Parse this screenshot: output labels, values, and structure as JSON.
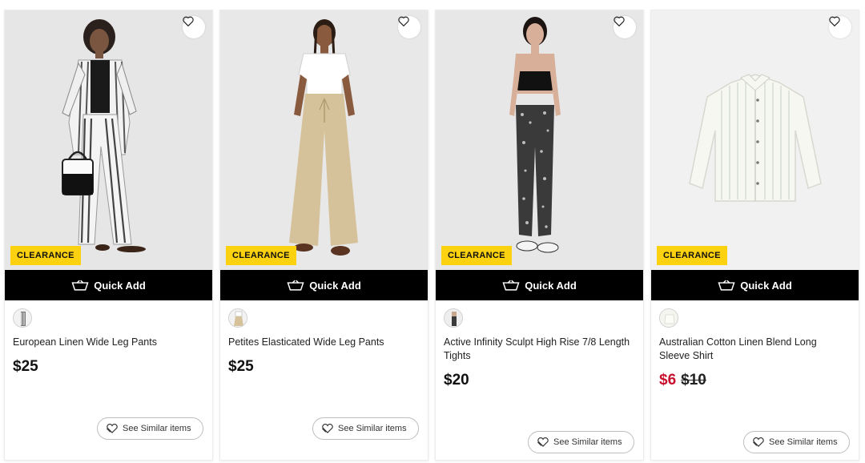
{
  "actions": {
    "quick_add": "Quick Add",
    "see_similar": "See Similar items"
  },
  "colors": {
    "clearance_badge": "#fcd10f",
    "quick_add_bg": "#000000",
    "sale_price": "#c8102e"
  },
  "products": [
    {
      "badge": "CLEARANCE",
      "name": "European Linen Wide Leg Pants",
      "price": "$25",
      "image": "model-striped-linen-outfit",
      "icons": [
        "heart-icon",
        "basket-icon",
        "similar-icon"
      ]
    },
    {
      "badge": "CLEARANCE",
      "name": "Petites Elasticated Wide Leg Pants",
      "price": "$25",
      "image": "model-beige-wide-leg-pants"
    },
    {
      "badge": "CLEARANCE",
      "name": "Active Infinity Sculpt High Rise 7/8 Length Tights",
      "price": "$20",
      "image": "model-printed-leggings"
    },
    {
      "badge": "CLEARANCE",
      "name": "Australian Cotton Linen Blend Long Sleeve Shirt",
      "sale_price": "$6",
      "original_price": "$10",
      "image": "striped-shirt-flatlay"
    }
  ]
}
